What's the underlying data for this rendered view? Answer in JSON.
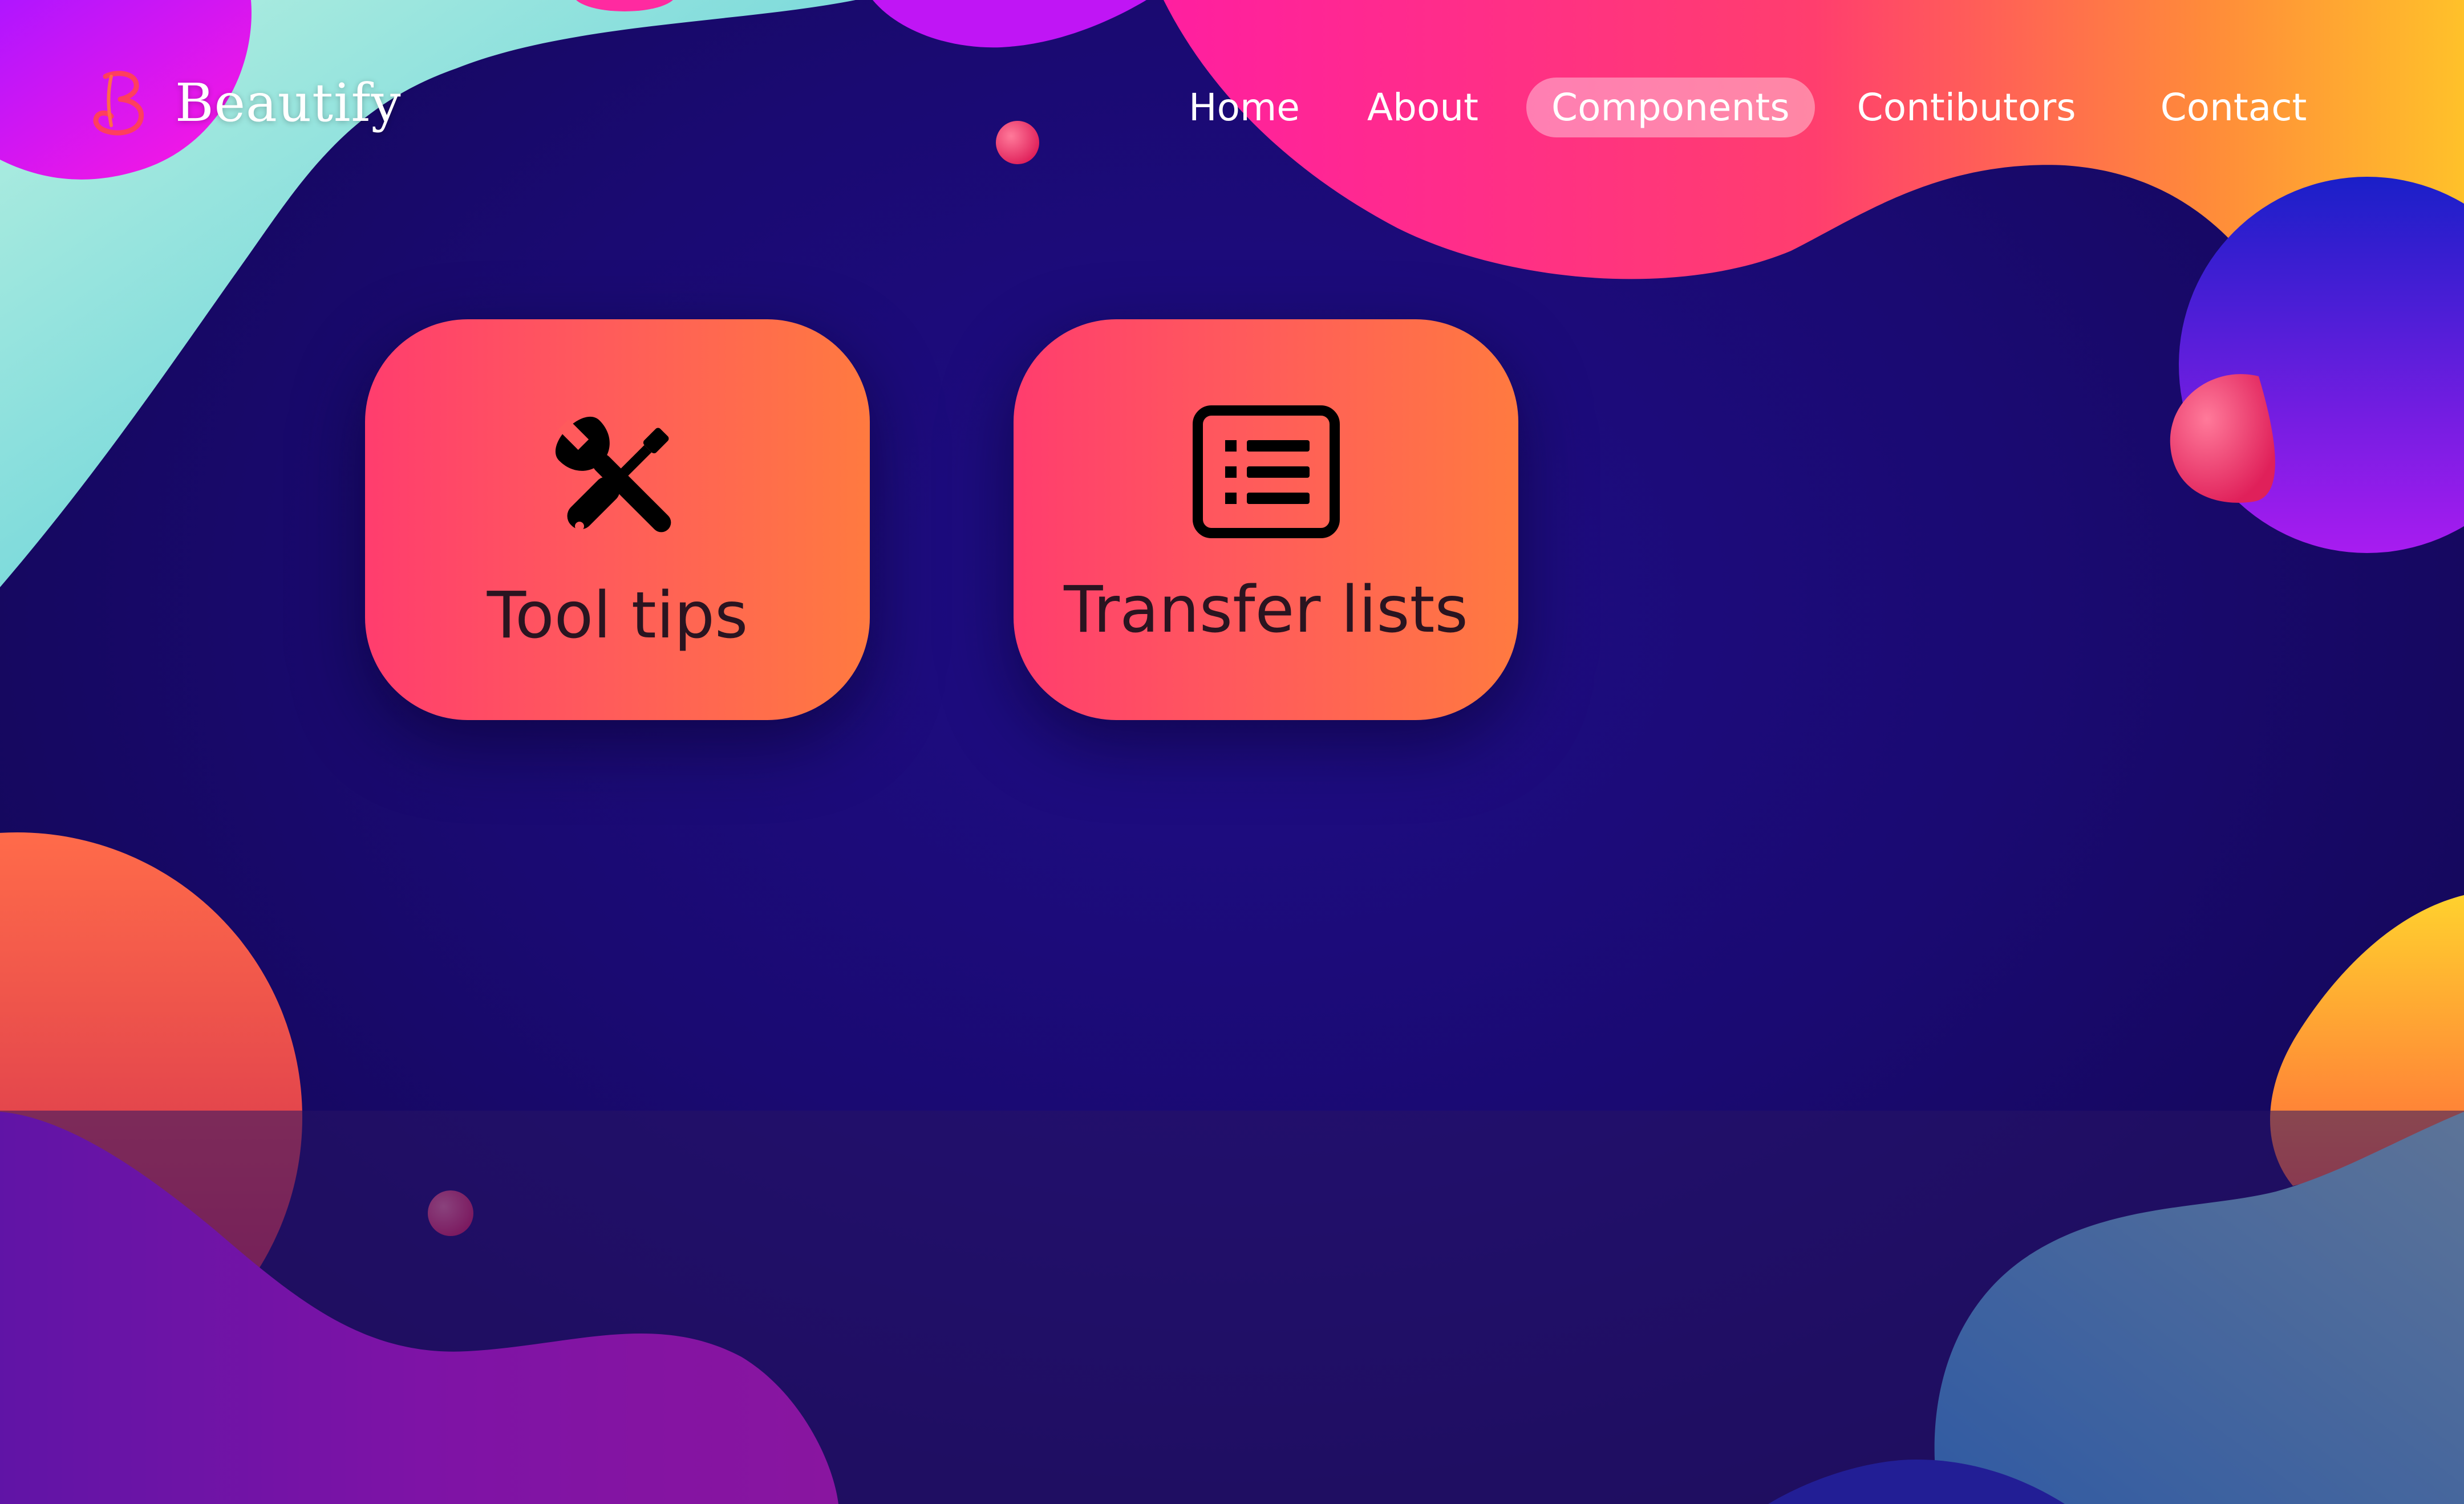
{
  "brand": {
    "name": "Beautify",
    "logo_icon": "b-logo-icon"
  },
  "nav": {
    "items": [
      {
        "label": "Home",
        "active": false
      },
      {
        "label": "About",
        "active": false
      },
      {
        "label": "Components",
        "active": true
      },
      {
        "label": "Contibutors",
        "active": false
      },
      {
        "label": "Contact",
        "active": false
      }
    ]
  },
  "cards": [
    {
      "label": "Tool tips",
      "icon": "tools-icon"
    },
    {
      "label": "Transfer lists",
      "icon": "list-icon"
    }
  ],
  "colors": {
    "background": "#1b0b6e",
    "card_gradient_start": "#ff3d6e",
    "card_gradient_end": "#ff7a40",
    "nav_active_bg": "rgba(255,255,255,0.38)",
    "text_light": "#ffffff",
    "card_text": "#2a1420"
  }
}
